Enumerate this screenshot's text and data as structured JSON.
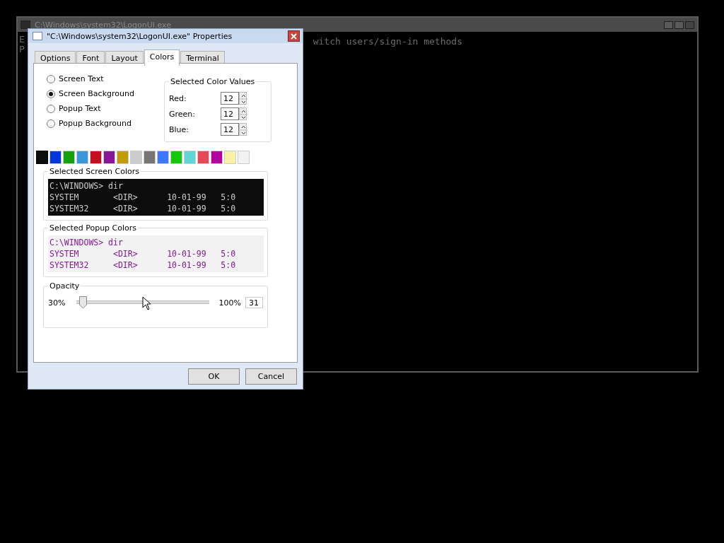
{
  "console": {
    "title": "C:\\Windows\\system32\\LogonUI.exe",
    "lines": [
      "E",
      "P"
    ],
    "visible_text": "witch users/sign-in methods"
  },
  "dialog": {
    "title": "\"C:\\Windows\\system32\\LogonUI.exe\" Properties",
    "tabs": [
      {
        "label": "Options",
        "selected": false
      },
      {
        "label": "Font",
        "selected": false
      },
      {
        "label": "Layout",
        "selected": false
      },
      {
        "label": "Colors",
        "selected": true
      },
      {
        "label": "Terminal",
        "selected": false
      }
    ],
    "targets": [
      {
        "label": "Screen Text",
        "selected": false
      },
      {
        "label": "Screen Background",
        "selected": true
      },
      {
        "label": "Popup Text",
        "selected": false
      },
      {
        "label": "Popup Background",
        "selected": false
      }
    ],
    "color_values": {
      "title": "Selected Color Values",
      "fields": [
        {
          "label": "Red:",
          "value": "12"
        },
        {
          "label": "Green:",
          "value": "12"
        },
        {
          "label": "Blue:",
          "value": "12"
        }
      ]
    },
    "swatches": [
      {
        "color": "#0c0c0c",
        "selected": true
      },
      {
        "color": "#0037da",
        "selected": false
      },
      {
        "color": "#13a10e",
        "selected": false
      },
      {
        "color": "#3a96dd",
        "selected": false
      },
      {
        "color": "#c50f1f",
        "selected": false
      },
      {
        "color": "#881798",
        "selected": false
      },
      {
        "color": "#c19c00",
        "selected": false
      },
      {
        "color": "#cccccc",
        "selected": false
      },
      {
        "color": "#767676",
        "selected": false
      },
      {
        "color": "#3b78ff",
        "selected": false
      },
      {
        "color": "#16c60c",
        "selected": false
      },
      {
        "color": "#61d6d6",
        "selected": false
      },
      {
        "color": "#e74856",
        "selected": false
      },
      {
        "color": "#b4009e",
        "selected": false
      },
      {
        "color": "#f9f1a5",
        "selected": false
      },
      {
        "color": "#f2f2f2",
        "selected": false
      }
    ],
    "screen_preview": {
      "title": "Selected Screen Colors",
      "lines": [
        "C:\\WINDOWS> dir",
        "SYSTEM       <DIR>      10-01-99   5:0",
        "SYSTEM32     <DIR>      10-01-99   5:0"
      ]
    },
    "popup_preview": {
      "title": "Selected Popup Colors",
      "lines": [
        "C:\\WINDOWS> dir",
        "SYSTEM       <DIR>      10-01-99   5:0",
        "SYSTEM32     <DIR>      10-01-99   5:0"
      ]
    },
    "opacity": {
      "title": "Opacity",
      "min_label": "30%",
      "max_label": "100%",
      "level": 0.02,
      "value": "31"
    },
    "buttons": [
      "OK",
      "Cancel"
    ]
  }
}
